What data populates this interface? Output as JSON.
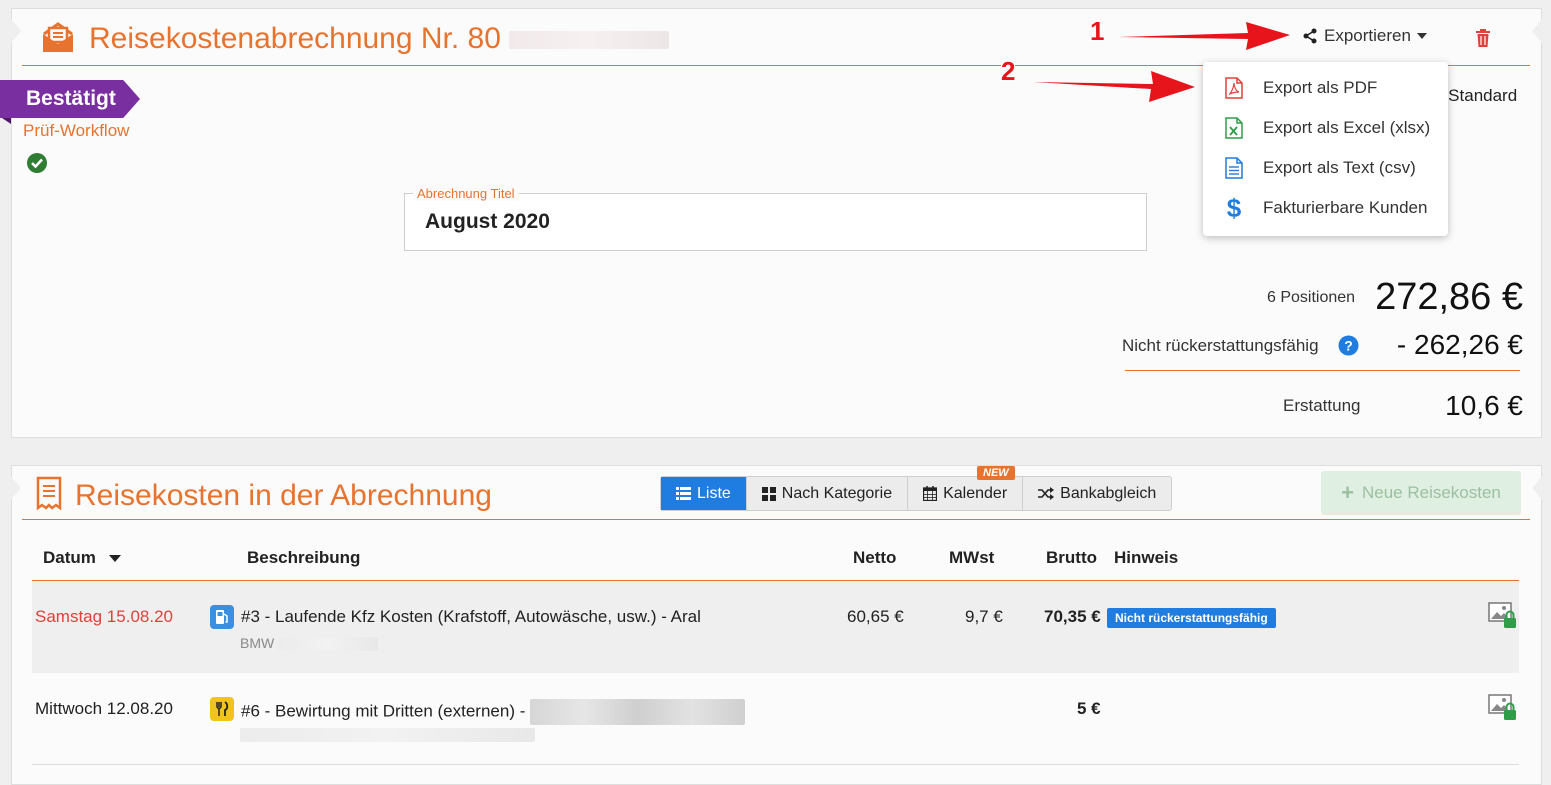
{
  "report": {
    "title": "Reisekostenabrechnung Nr. 80",
    "status_badge": "Bestätigt",
    "workflow_label": "Prüf-Workflow",
    "export_label": "Exportieren",
    "standard_partial": "e Standard",
    "field_label": "Abrechnung Titel",
    "field_value": "August 2020",
    "positions_label": "6 Positionen",
    "total": "272,86 €",
    "non_refundable_label": "Nicht rückerstattungsfähig",
    "non_refundable_value": "- 262,26 €",
    "refund_label": "Erstattung",
    "refund_value": "10,6 €"
  },
  "export_menu": {
    "items": [
      {
        "label": "Export als PDF",
        "icon": "pdf-file-icon",
        "color": "#e0413a"
      },
      {
        "label": "Export als Excel (xlsx)",
        "icon": "excel-file-icon",
        "color": "#2e9e48"
      },
      {
        "label": "Export als Text (csv)",
        "icon": "text-file-icon",
        "color": "#1f7ce0"
      },
      {
        "label": "Fakturierbare Kunden",
        "icon": "dollar-icon",
        "color": "#1f7ce0"
      }
    ]
  },
  "annotations": [
    "1",
    "2"
  ],
  "expenses": {
    "title": "Reisekosten in der Abrechnung",
    "tabs": [
      {
        "label": "Liste",
        "icon": "list-icon",
        "active": true
      },
      {
        "label": "Nach Kategorie",
        "icon": "grid-icon",
        "active": false
      },
      {
        "label": "Kalender",
        "icon": "calendar-icon",
        "active": false
      },
      {
        "label": "Bankabgleich",
        "icon": "shuffle-icon",
        "active": false
      }
    ],
    "new_badge": "NEW",
    "new_button": "Neue Reisekosten",
    "columns": {
      "date": "Datum",
      "description": "Beschreibung",
      "net": "Netto",
      "vat": "MWst",
      "gross": "Brutto",
      "note": "Hinweis"
    },
    "rows": [
      {
        "date": "Samstag 15.08.20",
        "category_icon": "fuel-icon",
        "description": "#3 - Laufende Kfz Kosten (Krafstoff, Autowäsche, usw.) - Aral",
        "sub": "BMW",
        "net": "60,65 €",
        "vat": "9,7 €",
        "gross": "70,35 €",
        "note": "Nicht rückerstattungsfähig"
      },
      {
        "date": "Mittwoch 12.08.20",
        "category_icon": "restaurant-icon",
        "description": "#6 - Bewirtung mit Dritten (externen) -",
        "sub": "",
        "net": "",
        "vat": "",
        "gross": "5 €",
        "note": ""
      }
    ]
  },
  "colors": {
    "accent": "#e8732f",
    "badge": "#7a2fa0",
    "primary": "#1f7ce0",
    "danger": "#e8141b",
    "success": "#2e7d32"
  }
}
